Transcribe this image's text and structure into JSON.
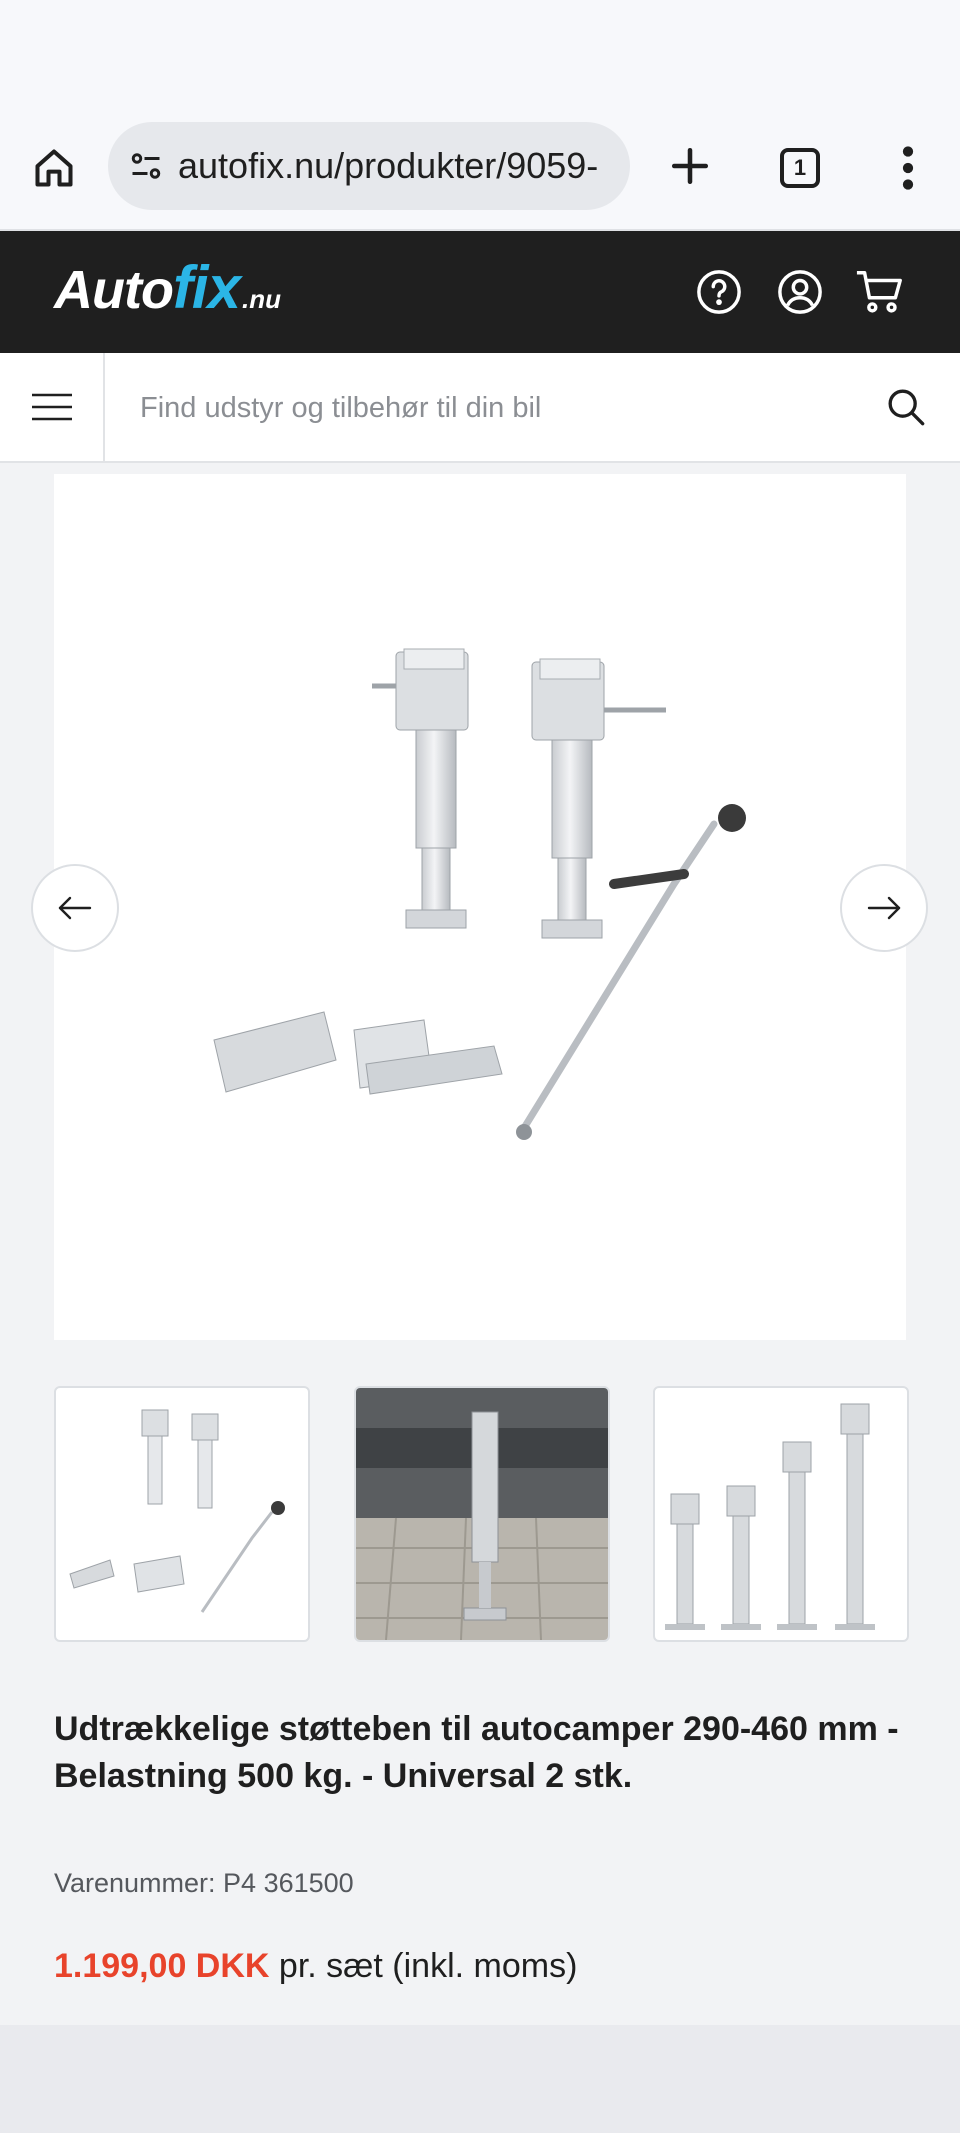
{
  "browser": {
    "url": "autofix.nu/produkter/9059-",
    "tab_count": "1",
    "icons": {
      "home": "home-icon",
      "site_info": "tune-icon",
      "new_tab": "plus-icon",
      "tabs": "tab-switcher-icon",
      "menu": "more-vert-icon"
    }
  },
  "header": {
    "logo": {
      "part1": "Auto",
      "part2": "fix",
      "part3": ".nu"
    },
    "icons": [
      "help-icon",
      "account-icon",
      "cart-icon"
    ],
    "colors": {
      "bar": "#1f1f1f",
      "logo_accent": "#2bb5e6"
    }
  },
  "search": {
    "placeholder": "Find udstyr og tilbehør til din bil"
  },
  "gallery": {
    "thumbnails": [
      "product-kit-thumbnail",
      "installed-under-camper-thumbnail",
      "extension-stages-thumbnail"
    ]
  },
  "product": {
    "title": "Udtrækkelige støtteben til autocamper 290-460 mm - Belastning 500 kg. - Universal 2 stk.",
    "sku": "Varenummer: P4 361500",
    "price": "1.199,00 DKK",
    "price_suffix": " pr. sæt (inkl. moms)",
    "price_color": "#e8432b"
  }
}
